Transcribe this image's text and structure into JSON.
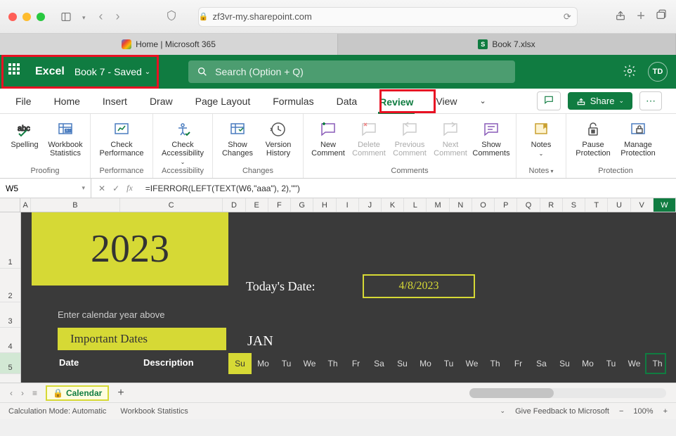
{
  "browser": {
    "url": "zf3vr-my.sharepoint.com",
    "tabs": [
      {
        "label": "Home | Microsoft 365"
      },
      {
        "label": "Book 7.xlsx"
      }
    ]
  },
  "header": {
    "app": "Excel",
    "doc": "Book 7",
    "saved": "Saved",
    "search_placeholder": "Search (Option + Q)",
    "avatar": "TD"
  },
  "ribbon_tabs": {
    "file": "File",
    "home": "Home",
    "insert": "Insert",
    "draw": "Draw",
    "page_layout": "Page Layout",
    "formulas": "Formulas",
    "data": "Data",
    "review": "Review",
    "view": "View",
    "share": "Share"
  },
  "ribbon": {
    "spelling": "Spelling",
    "workbook_stats": "Workbook Statistics",
    "check_perf": "Check Performance",
    "check_access": "Check Accessibility",
    "show_changes": "Show Changes",
    "version_history": "Version History",
    "new_comment": "New Comment",
    "delete_comment": "Delete Comment",
    "prev_comment": "Previous Comment",
    "next_comment": "Next Comment",
    "show_comments": "Show Comments",
    "notes": "Notes",
    "pause_protection": "Pause Protection",
    "manage_protection": "Manage Protection",
    "groups": {
      "proofing": "Proofing",
      "performance": "Performance",
      "accessibility": "Accessibility",
      "changes": "Changes",
      "comments": "Comments",
      "notes": "Notes",
      "protection": "Protection"
    }
  },
  "formula_bar": {
    "cell": "W5",
    "formula": "=IFERROR(LEFT(TEXT(W6,\"aaa\"), 2),\"\")"
  },
  "grid": {
    "columns": [
      "A",
      "B",
      "C",
      "D",
      "E",
      "F",
      "G",
      "H",
      "I",
      "J",
      "K",
      "L",
      "M",
      "N",
      "O",
      "P",
      "Q",
      "R",
      "S",
      "T",
      "U",
      "V",
      "W"
    ],
    "rows": [
      "1",
      "2",
      "3",
      "4",
      "5"
    ],
    "year": "2023",
    "today_label": "Today's Date:",
    "today_date": "4/8/2023",
    "enter_year": "Enter calendar year above",
    "important_dates": "Important Dates",
    "month": "JAN",
    "date_header": "Date",
    "desc_header": "Description",
    "days": [
      "Su",
      "Mo",
      "Tu",
      "We",
      "Th",
      "Fr",
      "Sa",
      "Su",
      "Mo",
      "Tu",
      "We",
      "Th",
      "Fr",
      "Sa",
      "Su",
      "Mo",
      "Tu",
      "We",
      "Th"
    ]
  },
  "sheet": {
    "name": "Calendar"
  },
  "status": {
    "calc": "Calculation Mode: Automatic",
    "stats": "Workbook Statistics",
    "feedback": "Give Feedback to Microsoft",
    "zoom": "100%"
  }
}
